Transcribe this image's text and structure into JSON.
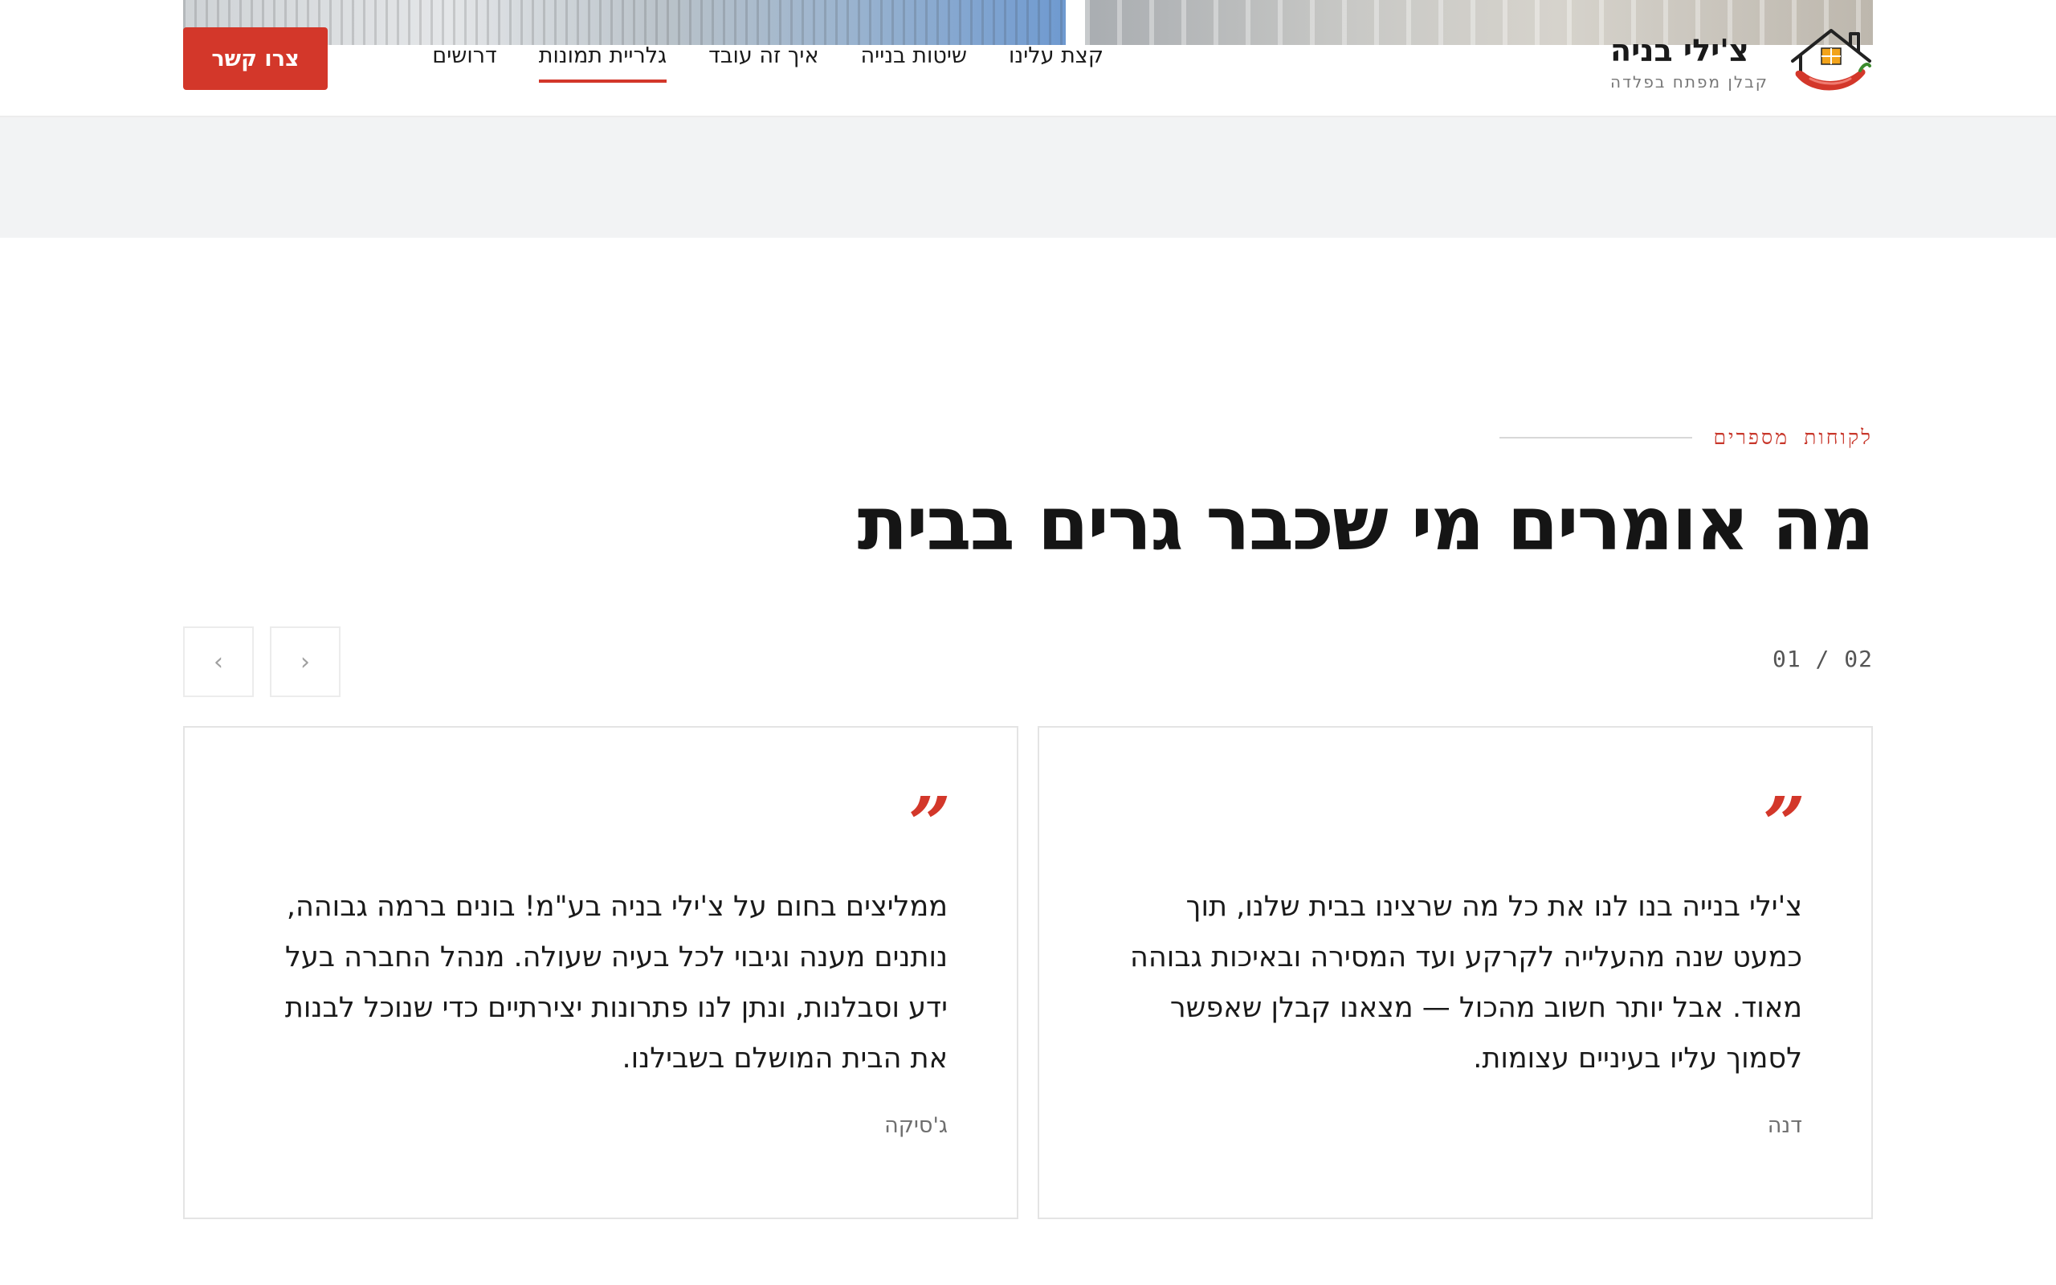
{
  "brand": {
    "name": "צ'ילי בניה",
    "tagline": "קבלן מפתח בפלדה"
  },
  "nav": {
    "items": [
      {
        "label": "קצת עלינו"
      },
      {
        "label": "שיטות בנייה"
      },
      {
        "label": "איך זה עובד"
      },
      {
        "label": "גלריית תמונות",
        "active": true
      },
      {
        "label": "דרושים"
      }
    ],
    "cta_label": "צרו קשר"
  },
  "colors": {
    "accent": "#d3372a",
    "text": "#1a1a1a",
    "muted": "#6e6e6e",
    "band": "#f2f3f4"
  },
  "testimonials": {
    "eyebrow": "לקוחות מספרים",
    "title": "מה אומרים מי שכבר גרים בבית",
    "counter": "01 / 02",
    "prev_icon": "chevron-left-icon",
    "next_icon": "chevron-right-icon",
    "quote_icon": "quote-icon",
    "items": [
      {
        "text": "צ'ילי בנייה בנו לנו את כל מה שרצינו בבית שלנו, תוך כמעט שנה מהעלייה לקרקע ועד המסירה ובאיכות גבוהה מאוד. אבל יותר חשוב מהכול — מצאנו קבלן שאפשר לסמוך עליו בעיניים עצומות.",
        "author": "דנה"
      },
      {
        "text": "ממליצים בחום על צ'ילי בניה בע\"מ! בונים ברמה גבוהה, נותנים מענה וגיבוי לכל בעיה שעולה. מנהל החברה בעל ידע וסבלנות, ונתן לנו פתרונות יצירתיים כדי שנוכל לבנות את הבית המושלם בשבילנו.",
        "author": "ג'סיקה"
      }
    ]
  }
}
